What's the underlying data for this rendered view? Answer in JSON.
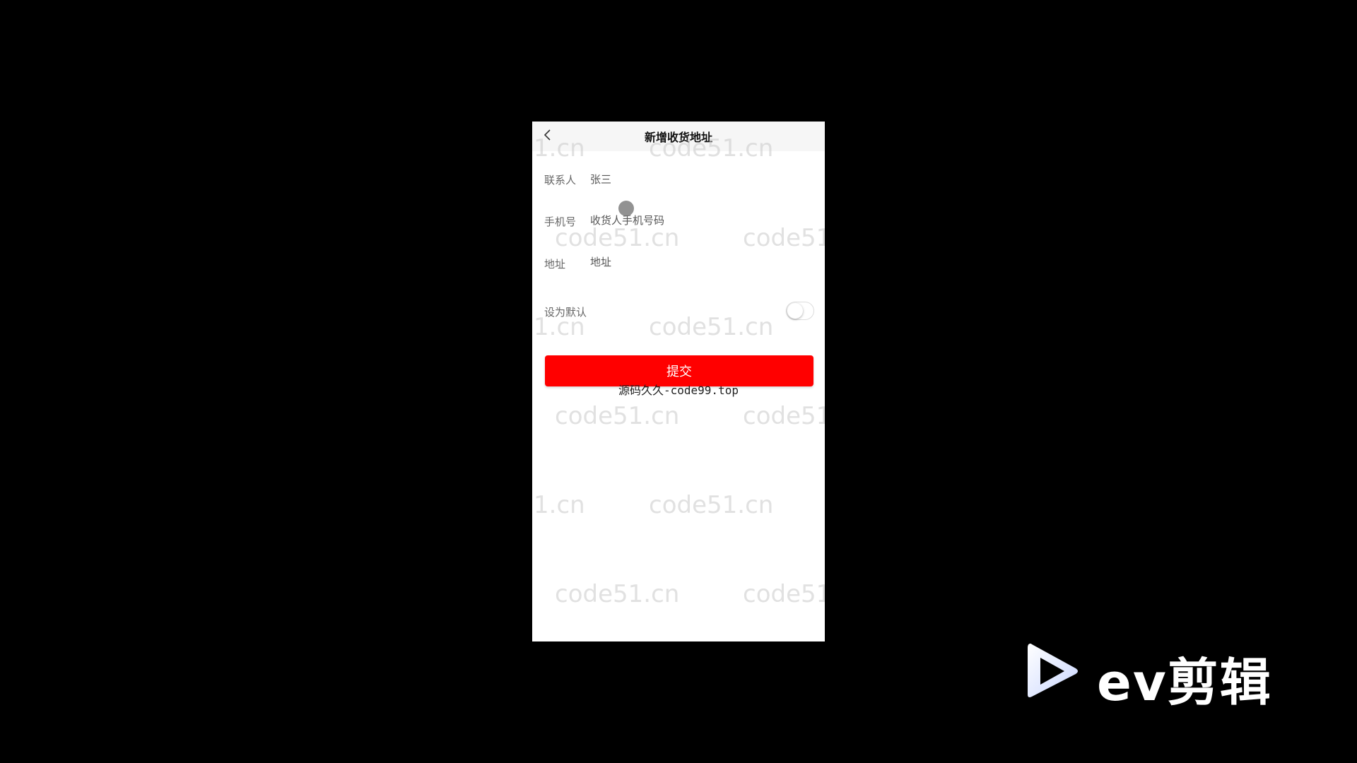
{
  "header": {
    "title": "新增收货地址",
    "back_icon": "chevron-left-icon"
  },
  "form": {
    "contact": {
      "label": "联系人",
      "value": "张三",
      "placeholder": ""
    },
    "phone": {
      "label": "手机号",
      "value": "",
      "placeholder": "收货人手机号码"
    },
    "address": {
      "label": "地址",
      "value": "",
      "placeholder": "地址"
    },
    "default": {
      "label": "设为默认",
      "checked": false
    }
  },
  "submit_label": "提交",
  "watermarks": {
    "site": "code51.cn",
    "site_partial": "1.cn",
    "site_cut": "code51",
    "center": "源码久久-code99.top"
  },
  "app_watermark": {
    "text": "ev剪辑",
    "icon": "play-logo-icon"
  },
  "colors": {
    "accent": "#ff0000",
    "background": "#000000",
    "screen": "#ffffff",
    "navbar": "#f6f6f6"
  }
}
